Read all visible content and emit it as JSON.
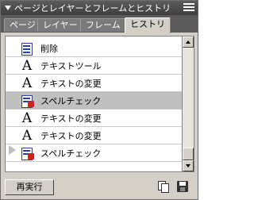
{
  "panel": {
    "title": "ページとレイヤーとフレームとヒストリ",
    "menu_icon": "panel-menu-icon"
  },
  "tabs": [
    {
      "label": "ページ",
      "active": false
    },
    {
      "label": "レイヤー",
      "active": false
    },
    {
      "label": "フレーム",
      "active": false
    },
    {
      "label": "ヒストリ",
      "active": true
    }
  ],
  "history": {
    "items": [
      {
        "label": "削除",
        "icon": "document-icon",
        "selected": false
      },
      {
        "label": "テキストツール",
        "icon": "text-tool-icon",
        "selected": false
      },
      {
        "label": "テキストの変更",
        "icon": "text-tool-icon",
        "selected": false
      },
      {
        "label": "スペルチェック",
        "icon": "spell-check-icon",
        "selected": true
      },
      {
        "label": "テキストの変更",
        "icon": "text-tool-icon",
        "selected": false
      },
      {
        "label": "テキストの変更",
        "icon": "text-tool-icon",
        "selected": false
      },
      {
        "label": "スペルチェック",
        "icon": "spell-check-icon",
        "selected": false
      }
    ],
    "glyph_text_icon": "A"
  },
  "footer": {
    "redo_label": "再実行",
    "copy_icon": "copy-steps-icon",
    "save_icon": "save-as-command-icon"
  },
  "colors": {
    "panel_bg": "#d4d0c8",
    "titlebar": "#4a4a4a",
    "selected_row": "#c0c0c0"
  }
}
